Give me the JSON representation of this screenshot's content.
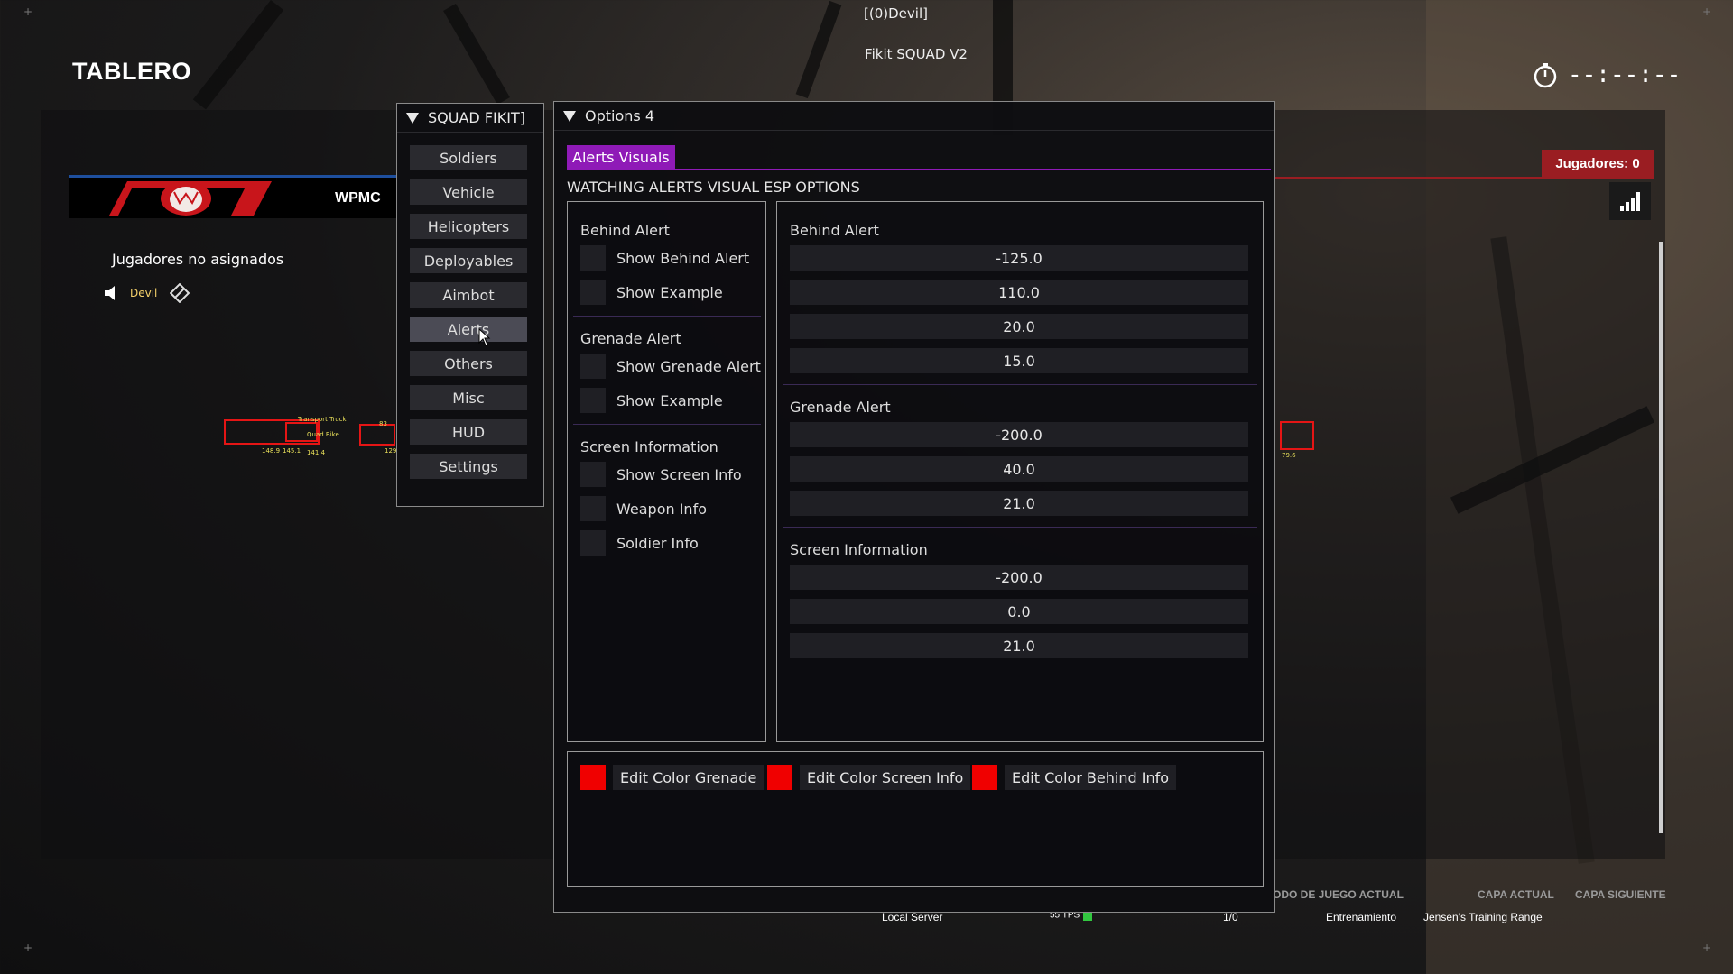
{
  "window": {
    "player_tag": "[(0)Devil]",
    "cheat_title": "Fikit SQUAD V2"
  },
  "scoreboard": {
    "title": "TABLERO",
    "timer": "--:--:--",
    "team_name": "WPMC",
    "unassigned_label": "Jugadores no asignados",
    "player_name": "Devil",
    "players_badge": "Jugadores: 0",
    "bottom": {
      "server": "Local Server",
      "tps": "55 TPS",
      "count": "1/0",
      "mode_head": "ODO DE JUEGO ACTUAL",
      "mode_value": "Entrenamiento",
      "layer_head": "CAPA ACTUAL",
      "layer_value": "Jensen's Training Range",
      "next_layer_head": "CAPA SIGUIENTE"
    }
  },
  "esp_labels": {
    "truck": "Transport Truck",
    "bike": "Quad Bike",
    "d1": "148.9",
    "d2": "145.1",
    "d3": "141.4",
    "d4": "129",
    "d5": "83",
    "d6": "79.6"
  },
  "nav": {
    "title": "SQUAD FIKIT]",
    "items": [
      "Soldiers",
      "Vehicle",
      "Helicopters",
      "Deployables",
      "Aimbot",
      "Alerts",
      "Others",
      "Misc",
      "HUD",
      "Settings"
    ],
    "active_index": 5
  },
  "options": {
    "title": "Options 4",
    "tab_active": "Alerts Visuals",
    "section_header": "WATCHING ALERTS VISUAL ESP OPTIONS",
    "left": {
      "behind_title": "Behind Alert",
      "behind_items": [
        "Show Behind Alert",
        "Show Example"
      ],
      "grenade_title": "Grenade Alert",
      "grenade_items": [
        "Show Grenade Alert",
        "Show Example"
      ],
      "screen_title": "Screen Information",
      "screen_items": [
        "Show Screen Info",
        "Weapon Info",
        "Soldier Info"
      ]
    },
    "right": {
      "behind_title": "Behind Alert",
      "behind_values": [
        "-125.0",
        "110.0",
        "20.0",
        "15.0"
      ],
      "grenade_title": "Grenade Alert",
      "grenade_values": [
        "-200.0",
        "40.0",
        "21.0"
      ],
      "screen_title": "Screen Information",
      "screen_values": [
        "-200.0",
        "0.0",
        "21.0"
      ]
    },
    "color_buttons": [
      "Edit Color Grenade",
      "Edit Color Screen Info",
      "Edit Color Behind Info"
    ],
    "swatch_color": "#f00000"
  }
}
